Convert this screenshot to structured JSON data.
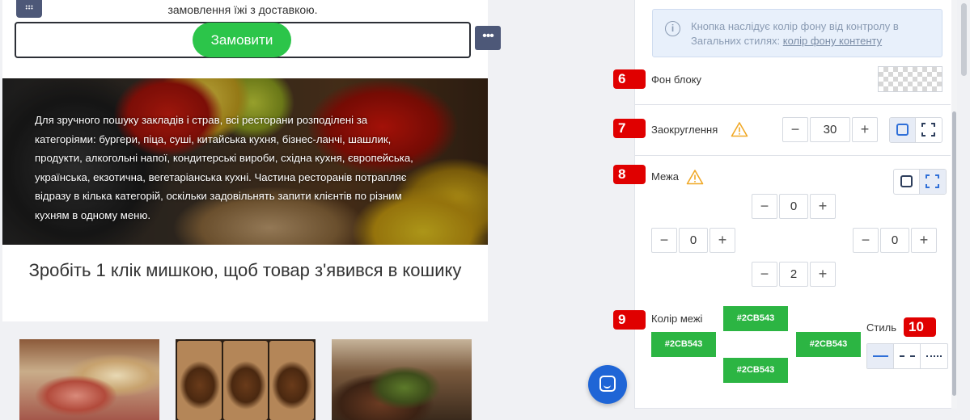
{
  "canvas": {
    "top_text": "замовлення їжі з доставкою.",
    "order_button": "Замовити",
    "more_label": "•••",
    "banner_text": "Для зручного пошуку закладів і страв, всі ресторани розподілені за категоріями: бургери, піца, суші, китайська кухня, бізнес-ланчі, шашлик, продукти, алкогольні напої, кондитерські вироби, східна кухня, європейська, українська, екзотична, вегетаріанська кухні. Частина ресторанів потрапляє відразу в кілька категорій, оскільки задовільнять запити клієнтів по різним кухням в одному меню.",
    "headline": "Зробіть 1 клік мишкою, щоб товар з'явився в кошику"
  },
  "panel": {
    "info": {
      "text": "Кнопка наслідує колір фону від контролу в Загальних стилях: ",
      "link": "колір фону контенту"
    },
    "badges": {
      "b6": "6",
      "b7": "7",
      "b8": "8",
      "b9": "9",
      "b10": "10"
    },
    "block_bg_label": "Фон блоку",
    "rounding": {
      "label": "Заокруглення",
      "value": "30",
      "minus": "−",
      "plus": "+"
    },
    "border": {
      "label": "Межа",
      "top": "0",
      "left": "0",
      "right": "0",
      "bottom": "2",
      "minus": "−",
      "plus": "+"
    },
    "border_color": {
      "label": "Колір межі",
      "top": "#2CB543",
      "left": "#2CB543",
      "right": "#2CB543",
      "bottom": "#2CB543"
    },
    "style_label": "Стиль",
    "colors": {
      "accent_green": "#2cb543",
      "badge_red": "#e00000",
      "active_blue": "#2f6fd8"
    }
  }
}
